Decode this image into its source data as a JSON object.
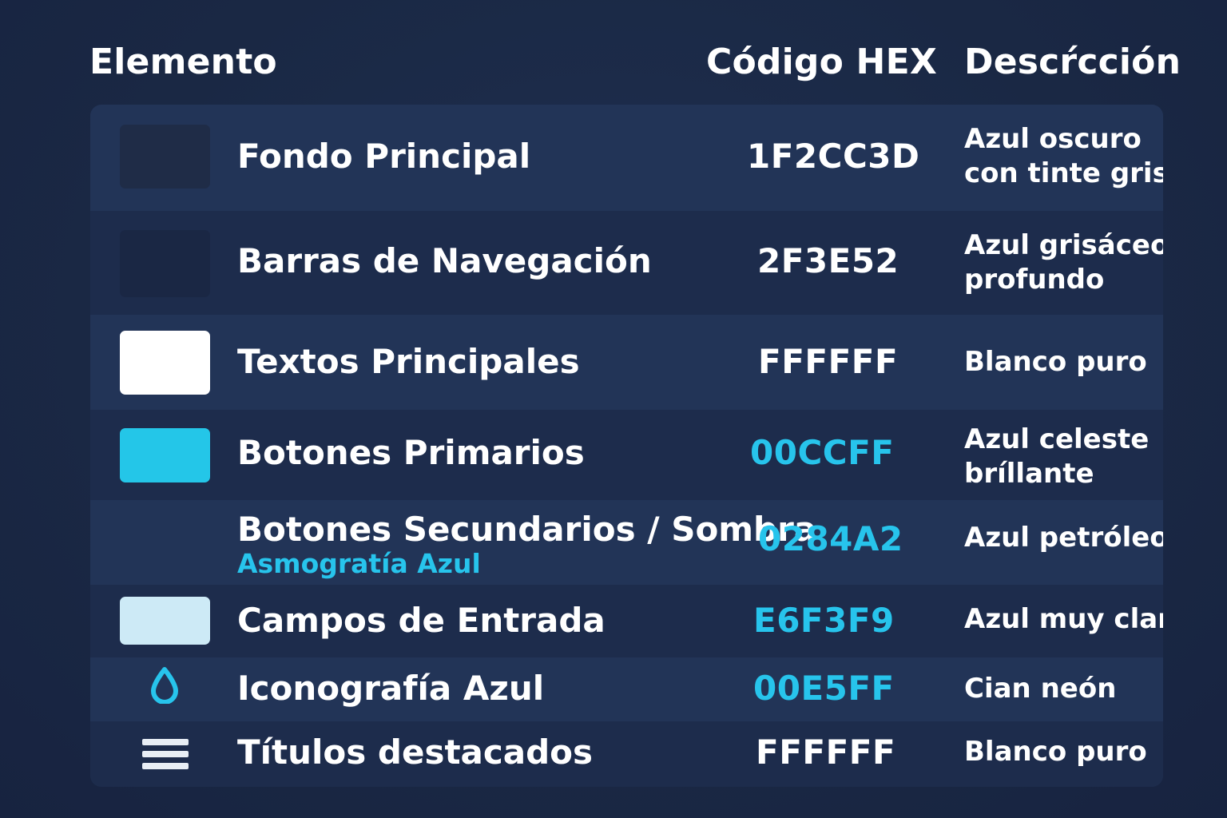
{
  "headers": {
    "element": "Elemento",
    "hex": "Código HEX",
    "description": "Descŕcción"
  },
  "rows": [
    {
      "name": "Fondo Principal",
      "hex": "1F2CC3D",
      "desc_line1": "Azul oscuro",
      "desc_line2": "con tinte gris",
      "swatch_color": "#1f2c47",
      "hex_color": "#ffffff"
    },
    {
      "name": "Barras de Navegación",
      "hex": "2F3E52",
      "desc_line1": "Azul grisáceo",
      "desc_line2": "profundo",
      "swatch_color": "#1a2744",
      "hex_color": "#ffffff"
    },
    {
      "name": "Textos Principales",
      "hex": "FFFFFF",
      "desc_line1": "Blanco puro",
      "swatch_color": "#ffffff",
      "hex_color": "#ffffff"
    },
    {
      "name": "Botones Primarios",
      "hex": "00CCFF",
      "desc_line1": "Azul celeste",
      "desc_line2": "bríllante",
      "swatch_color": "#24c6e8",
      "hex_color": "#27c4ec"
    },
    {
      "name": "Botones Secundarios / Sombra",
      "subtitle": "Asmogratía Azul",
      "hex": "0284A2",
      "desc_line1": "Azul petróleo",
      "hex_color": "#27c4ec"
    },
    {
      "name": "Campos de Entrada",
      "hex": "E6F3F9",
      "desc_line1": "Azul muy claro",
      "swatch_color": "#cdeaf6",
      "hex_color": "#27c4ec"
    },
    {
      "name": "Iconografía Azul",
      "hex": "00E5FF",
      "desc_line1": "Cian neón",
      "icon": "droplet-icon",
      "icon_color": "#27c4ec",
      "hex_color": "#27c4ec"
    },
    {
      "name": "Títulos destacados",
      "hex": "FFFFFF",
      "desc_line1": "Blanco puro",
      "icon": "hamburger-menu-icon",
      "icon_color": "#e8eef5",
      "hex_color": "#ffffff"
    }
  ]
}
